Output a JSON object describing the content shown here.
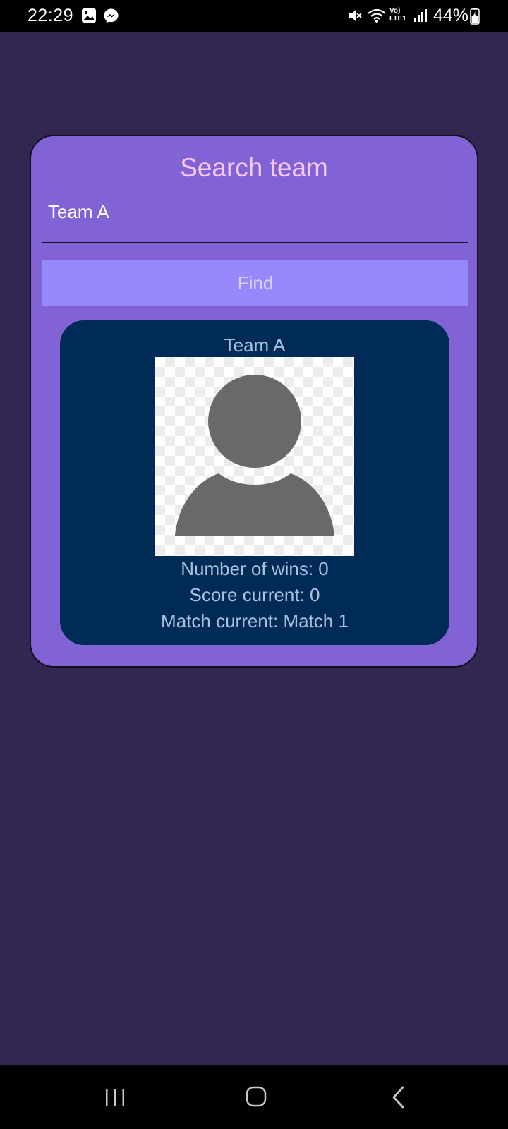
{
  "status_bar": {
    "time": "22:29",
    "battery": "44%",
    "network_label": "Vo) LTE1",
    "icons": [
      "image-icon",
      "messenger-icon",
      "mute-icon",
      "wifi-icon",
      "signal-icon",
      "battery-icon"
    ]
  },
  "search": {
    "title": "Search team",
    "input_value": "Team A",
    "find_label": "Find"
  },
  "result": {
    "team_name": "Team A",
    "avatar_icon": "person-icon",
    "wins": "Number of wins: 0",
    "score": "Score current: 0",
    "match": "Match current: Match 1"
  },
  "nav_bar": {
    "icons": [
      "recent-apps-icon",
      "home-icon",
      "back-icon"
    ]
  },
  "colors": {
    "background": "#322750",
    "card": "#8263d5",
    "title": "#f7c9f2",
    "find_button": "#9488fb",
    "result_panel": "#002b56",
    "result_text": "#a9c1df"
  }
}
